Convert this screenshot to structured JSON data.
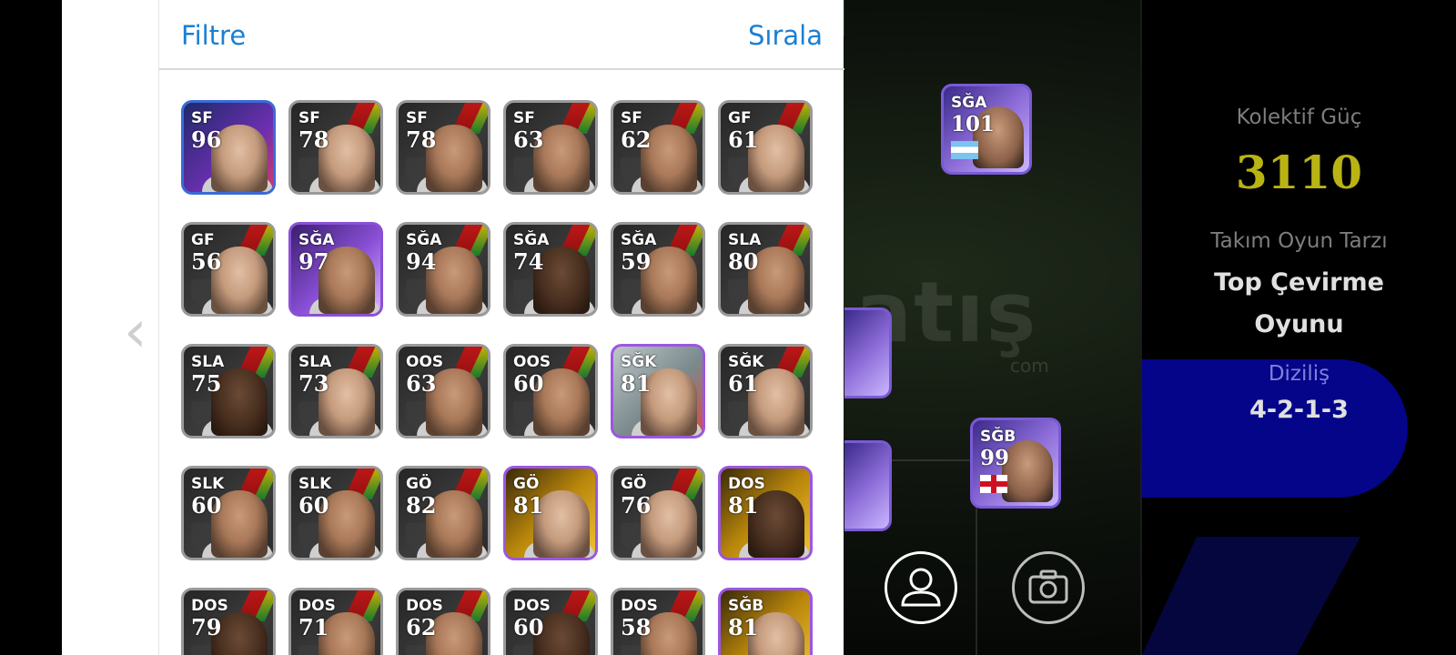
{
  "header": {
    "filter_label": "Filtre",
    "sort_label": "Sırala"
  },
  "players": [
    {
      "pos": "SF",
      "rating": "96",
      "style": "blue",
      "face": "light"
    },
    {
      "pos": "SF",
      "rating": "78",
      "style": "normal",
      "face": "light"
    },
    {
      "pos": "SF",
      "rating": "78",
      "style": "normal",
      "face": "mid"
    },
    {
      "pos": "SF",
      "rating": "63",
      "style": "normal",
      "face": "mid"
    },
    {
      "pos": "SF",
      "rating": "62",
      "style": "normal",
      "face": "mid"
    },
    {
      "pos": "GF",
      "rating": "61",
      "style": "normal",
      "face": "light"
    },
    {
      "pos": "GF",
      "rating": "56",
      "style": "normal",
      "face": "light"
    },
    {
      "pos": "SĞA",
      "rating": "97",
      "style": "purple",
      "face": "mid"
    },
    {
      "pos": "SĞA",
      "rating": "94",
      "style": "normal",
      "face": "mid"
    },
    {
      "pos": "SĞA",
      "rating": "74",
      "style": "normal",
      "face": "dark"
    },
    {
      "pos": "SĞA",
      "rating": "59",
      "style": "normal",
      "face": "mid"
    },
    {
      "pos": "SLA",
      "rating": "80",
      "style": "normal",
      "face": "mid"
    },
    {
      "pos": "SLA",
      "rating": "75",
      "style": "normal",
      "face": "dark"
    },
    {
      "pos": "SLA",
      "rating": "73",
      "style": "normal",
      "face": "light"
    },
    {
      "pos": "OOS",
      "rating": "63",
      "style": "normal",
      "face": "mid"
    },
    {
      "pos": "OOS",
      "rating": "60",
      "style": "normal",
      "face": "mid"
    },
    {
      "pos": "SĞK",
      "rating": "81",
      "style": "light",
      "face": "light"
    },
    {
      "pos": "SĞK",
      "rating": "61",
      "style": "normal",
      "face": "light"
    },
    {
      "pos": "SLK",
      "rating": "60",
      "style": "normal",
      "face": "mid"
    },
    {
      "pos": "SLK",
      "rating": "60",
      "style": "normal",
      "face": "mid"
    },
    {
      "pos": "GÖ",
      "rating": "82",
      "style": "normal",
      "face": "mid"
    },
    {
      "pos": "GÖ",
      "rating": "81",
      "style": "gold",
      "face": "light"
    },
    {
      "pos": "GÖ",
      "rating": "76",
      "style": "normal",
      "face": "light"
    },
    {
      "pos": "DOS",
      "rating": "81",
      "style": "gold",
      "face": "dark"
    },
    {
      "pos": "DOS",
      "rating": "79",
      "style": "normal",
      "face": "dark"
    },
    {
      "pos": "DOS",
      "rating": "71",
      "style": "normal",
      "face": "mid"
    },
    {
      "pos": "DOS",
      "rating": "62",
      "style": "normal",
      "face": "mid"
    },
    {
      "pos": "DOS",
      "rating": "60",
      "style": "normal",
      "face": "dark"
    },
    {
      "pos": "DOS",
      "rating": "58",
      "style": "normal",
      "face": "mid"
    },
    {
      "pos": "SĞB",
      "rating": "81",
      "style": "gold",
      "face": "light"
    }
  ],
  "field_cards": [
    {
      "pos": "SĞA",
      "rating": "101",
      "flag": "argentina"
    },
    {
      "pos": "SĞB",
      "rating": "99",
      "flag": "england"
    }
  ],
  "watermark": {
    "main": "atış",
    "sub": "com"
  },
  "stats": {
    "power_label": "Kolektif Güç",
    "power_value": "3110",
    "style_label": "Takım Oyun Tarzı",
    "style_value_line1": "Top Çevirme",
    "style_value_line2": "Oyunu",
    "formation_label": "Diziliş",
    "formation_value": "4-2-1-3"
  },
  "icons": {
    "profile": "user-icon",
    "camera": "camera-icon",
    "prev": "chevron-left-icon"
  },
  "colors": {
    "accent": "#1a7fd4",
    "power": "#b9b413",
    "formation_bg": "#05058a"
  }
}
